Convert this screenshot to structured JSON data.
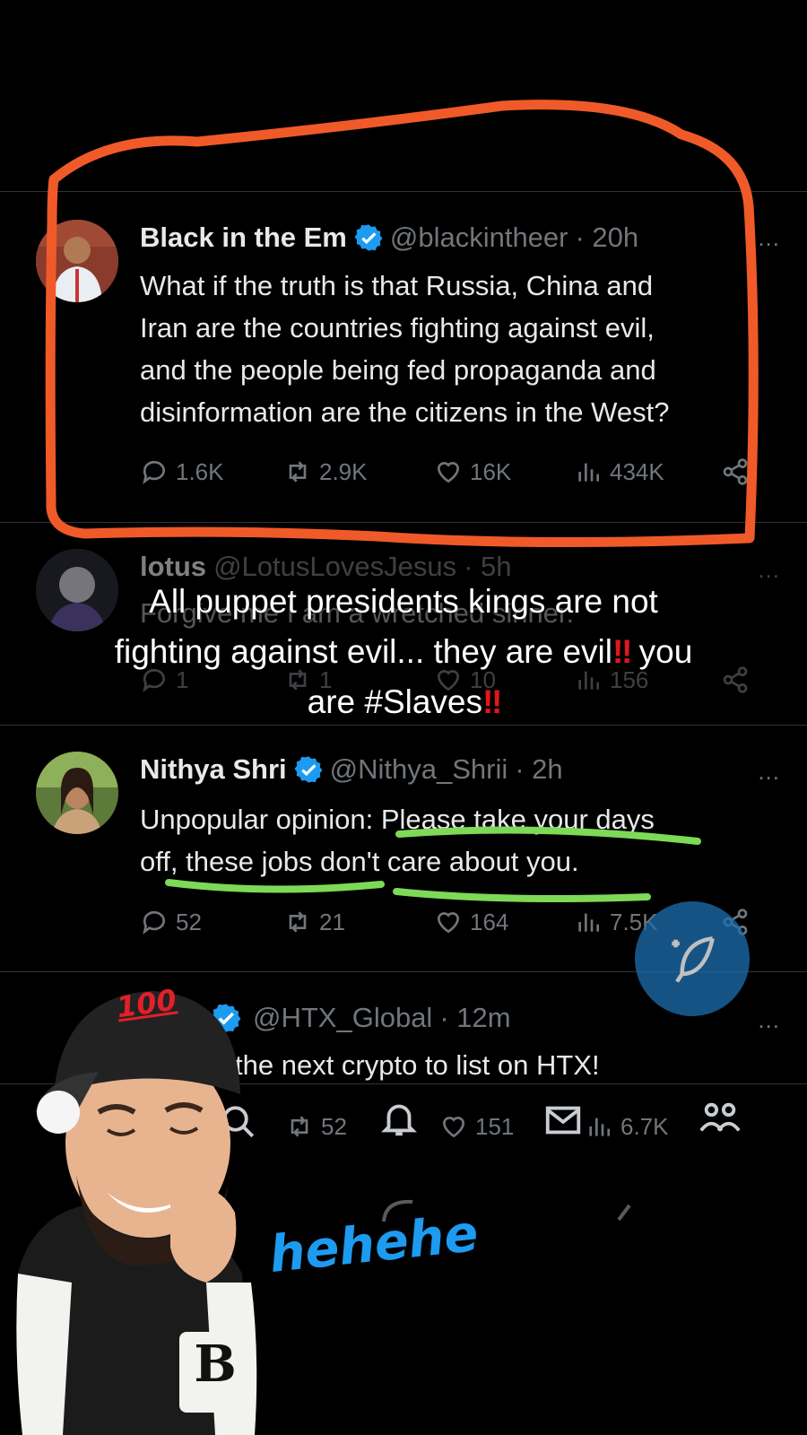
{
  "tweets": [
    {
      "name": "Black in the Em",
      "handle": "@blackintheer",
      "time": "· 20h",
      "lines": [
        "What if the truth is that Russia, China and",
        "Iran are the countries fighting against evil,",
        "and the people being fed propaganda and",
        "disinformation are the citizens in the West?"
      ],
      "replies": "1.6K",
      "reposts": "2.9K",
      "likes": "16K",
      "views": "434K"
    },
    {
      "name": "lotus",
      "handle": "@LotusLovesJesus",
      "time": "· 5h",
      "lines": [
        "Forgive me I am a wretched sinner."
      ],
      "replies": "1",
      "reposts": "1",
      "likes": "10",
      "views": "156"
    },
    {
      "name": "Nithya Shri",
      "handle": "@Nithya_Shrii",
      "time": "· 2h",
      "lines": [
        "Unpopular opinion: Please take your days",
        "off, these jobs don't care about you."
      ],
      "replies": "52",
      "reposts": "21",
      "likes": "164",
      "views": "7.5K"
    },
    {
      "name": "",
      "handle": "@HTX_Global",
      "time": "· 12m",
      "lines": [
        "the next crypto to list on HTX!"
      ],
      "replies": "",
      "reposts": "52",
      "likes": "151",
      "views": "6.7K"
    }
  ],
  "more_icon": "...",
  "caption": {
    "line1": "All puppet presidents kings are not",
    "line2a": "fighting against evil... they are evil",
    "line2b": "you",
    "line3": "are #Slaves",
    "bang": "‼"
  },
  "sticker_text": "hehehe",
  "cap_badge": "100",
  "jacket_letter": "B",
  "colors": {
    "highlight_outline": "#f05a28",
    "underline": "#7ed957",
    "verified": "#1d9bf0",
    "fab": "#1d6fb1"
  },
  "icons": [
    "reply-icon",
    "repost-icon",
    "like-icon",
    "views-icon",
    "share-icon",
    "verified-icon",
    "compose-icon",
    "search-icon",
    "bell-icon",
    "mail-icon",
    "communities-icon"
  ]
}
